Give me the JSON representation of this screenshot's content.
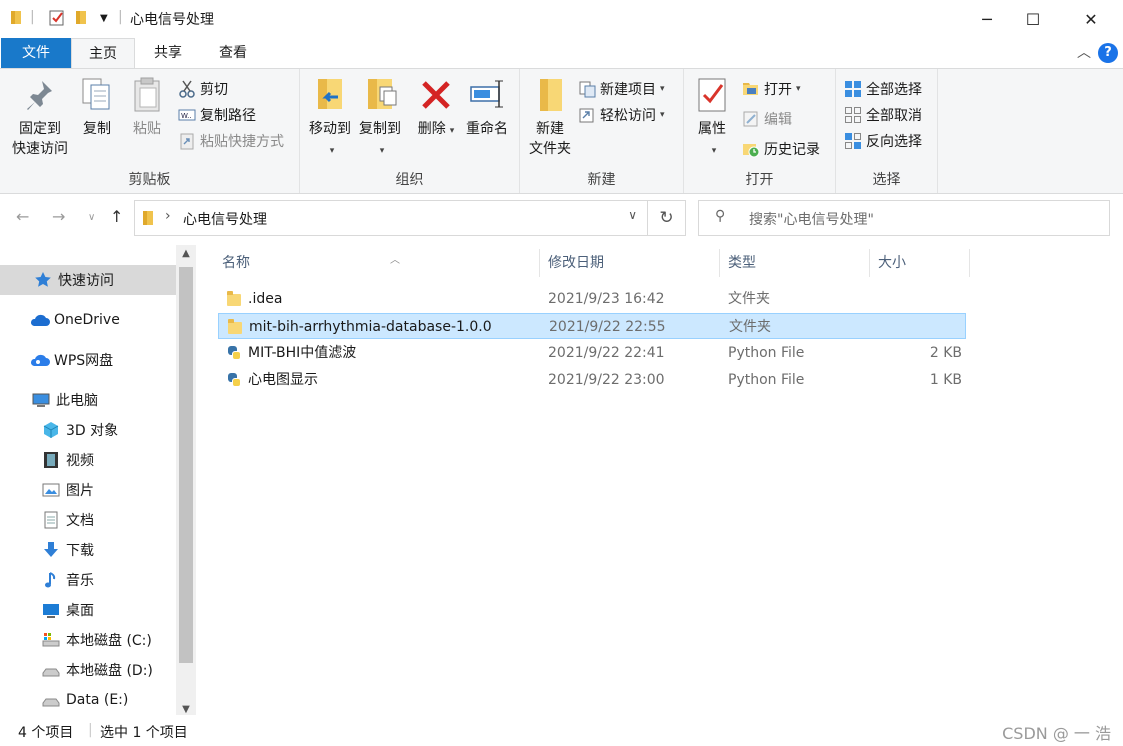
{
  "window": {
    "title": "心电信号处理",
    "minimize_glyph": "─",
    "maximize_glyph": "☐",
    "close_glyph": "✕"
  },
  "ribbon_tabs": {
    "file": "文件",
    "home": "主页",
    "share": "共享",
    "view": "查看",
    "help": "?"
  },
  "ribbon": {
    "clipboard": {
      "label": "剪贴板",
      "pin_line1": "固定到",
      "pin_line2": "快速访问",
      "copy": "复制",
      "paste": "粘贴",
      "cut": "剪切",
      "copy_path": "复制路径",
      "paste_shortcut": "粘贴快捷方式"
    },
    "organize": {
      "label": "组织",
      "move_to": "移动到",
      "copy_to": "复制到",
      "delete": "删除",
      "rename": "重命名"
    },
    "new": {
      "label": "新建",
      "new_folder_line1": "新建",
      "new_folder_line2": "文件夹",
      "new_item": "新建项目",
      "easy_access": "轻松访问"
    },
    "open": {
      "label": "打开",
      "properties": "属性",
      "open": "打开",
      "edit": "编辑",
      "history": "历史记录"
    },
    "select": {
      "label": "选择",
      "select_all": "全部选择",
      "select_none": "全部取消",
      "invert": "反向选择"
    }
  },
  "address_bar": {
    "path": "心电信号处理",
    "search_placeholder": "搜索\"心电信号处理\""
  },
  "nav_pane": {
    "items": [
      {
        "label": "快速访问",
        "icon": "star-icon"
      },
      {
        "label": "OneDrive",
        "icon": "cloud-icon"
      },
      {
        "label": "WPS网盘",
        "icon": "cloud-icon"
      },
      {
        "label": "此电脑",
        "icon": "computer-icon"
      },
      {
        "label": "3D 对象",
        "icon": "cube-icon"
      },
      {
        "label": "视频",
        "icon": "film-icon"
      },
      {
        "label": "图片",
        "icon": "picture-icon"
      },
      {
        "label": "文档",
        "icon": "document-icon"
      },
      {
        "label": "下载",
        "icon": "download-icon"
      },
      {
        "label": "音乐",
        "icon": "music-icon"
      },
      {
        "label": "桌面",
        "icon": "desktop-icon"
      },
      {
        "label": "本地磁盘 (C:)",
        "icon": "drive-icon"
      },
      {
        "label": "本地磁盘 (D:)",
        "icon": "drive-icon"
      },
      {
        "label": "Data (E:)",
        "icon": "drive-icon"
      }
    ]
  },
  "file_list": {
    "columns": {
      "name": "名称",
      "date": "修改日期",
      "type": "类型",
      "size": "大小"
    },
    "rows": [
      {
        "name": ".idea",
        "date": "2021/9/23 16:42",
        "type": "文件夹",
        "size": "",
        "icon": "folder-icon"
      },
      {
        "name": "mit-bih-arrhythmia-database-1.0.0",
        "date": "2021/9/22 22:55",
        "type": "文件夹",
        "size": "",
        "icon": "folder-icon"
      },
      {
        "name": "MIT-BHI中值滤波",
        "date": "2021/9/22 22:41",
        "type": "Python File",
        "size": "2 KB",
        "icon": "python-file-icon"
      },
      {
        "name": "心电图显示",
        "date": "2021/9/22 23:00",
        "type": "Python File",
        "size": "1 KB",
        "icon": "python-file-icon"
      }
    ]
  },
  "status_bar": {
    "item_count": "4 个项目",
    "selected_count": "选中 1 个项目",
    "watermark": "CSDN @ 一 浩"
  },
  "colors": {
    "accent": "#1979ca",
    "selection_bg": "#cce8ff",
    "selection_border": "#99d1ff",
    "folder": "#f8d775"
  }
}
